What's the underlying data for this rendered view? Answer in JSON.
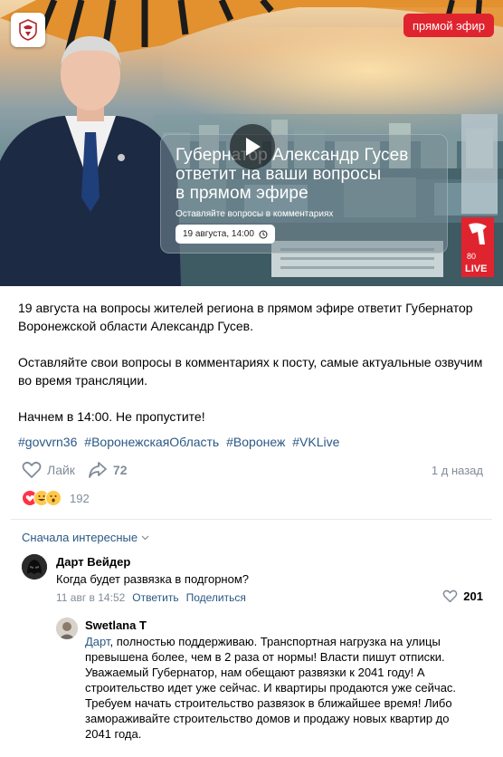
{
  "video": {
    "live_badge": "прямой эфир",
    "card_title": "Губернатор Александр Гусев\nответит на ваши вопросы\nв прямом эфире",
    "card_subtitle": "Оставляйте вопросы в комментариях",
    "date_label": "19 августа, 14:00",
    "brand_text": "LIVE",
    "brand_number": "80"
  },
  "post": {
    "paragraphs": [
      "19 августа на вопросы жителей региона в прямом эфире ответит Губернатор Воронежской области Александр Гусев.",
      "Оставляйте свои вопросы в комментариях к посту, самые актуальные озвучим во время трансляции.",
      "Начнем в 14:00. Не пропустите!"
    ],
    "hashtags": [
      "#govvrn36",
      "#ВоронежскаяОбласть",
      "#Воронеж",
      "#VKLive"
    ]
  },
  "actions": {
    "like_label": "Лайк",
    "share_count": "72",
    "time": "1 д назад",
    "reaction_count": "192"
  },
  "comments_sort": "Сначала интересные",
  "comments": [
    {
      "author": "Дарт Вейдер",
      "text": "Когда будет развязка в подгорном?",
      "date": "11 авг в 14:52",
      "reply_label": "Ответить",
      "share_label": "Поделиться",
      "likes": "201"
    }
  ],
  "reply": {
    "author": "Swetlana T",
    "mention": "Дарт",
    "text": ", полностью поддерживаю. Транспортная нагрузка на улицы превышена более, чем в 2 раза от нормы! Власти пишут отписки. Уважаемый Губернатор, нам обещают развязки к 2041 году! А строительство идет уже сейчас. И квартиры продаются уже сейчас. Требуем начать строительство развязок в ближайшее время! Либо замораживайте строительство домов и продажу новых квартир до 2041 года."
  },
  "colors": {
    "accent": "#2a5885",
    "muted": "#818c99",
    "live_red": "#e0242f"
  }
}
